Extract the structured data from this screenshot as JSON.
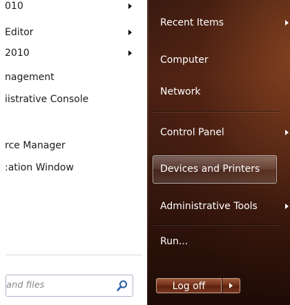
{
  "programs": [
    {
      "label": "010",
      "has_submenu": true
    },
    {
      "label": "Editor",
      "has_submenu": true
    },
    {
      "label": "2010",
      "has_submenu": true
    },
    {
      "label": "nagement",
      "has_submenu": false
    },
    {
      "label": "iistrative Console",
      "has_submenu": false
    },
    {
      "label": "rce Manager",
      "has_submenu": false
    },
    {
      "label": ":ation Window",
      "has_submenu": false
    }
  ],
  "search": {
    "placeholder": "and files"
  },
  "right_menu": [
    {
      "label": "Recent Items",
      "has_submenu": true
    },
    {
      "label": "Computer",
      "has_submenu": false
    },
    {
      "label": "Network",
      "has_submenu": false
    },
    {
      "label": "Control Panel",
      "has_submenu": true
    },
    {
      "label": "Devices and Printers",
      "has_submenu": false,
      "highlighted": true
    },
    {
      "label": "Administrative Tools",
      "has_submenu": true
    },
    {
      "label": "Run...",
      "has_submenu": false
    }
  ],
  "logoff": {
    "label": "Log off"
  },
  "icons": {
    "search": "magnifier-icon",
    "submenu": "chevron-right-icon"
  },
  "colors": {
    "menu_bg": "#ffffff",
    "right_pane": "#3f1b10",
    "text_dark": "#1a1a1a",
    "text_light": "#ffffff"
  }
}
